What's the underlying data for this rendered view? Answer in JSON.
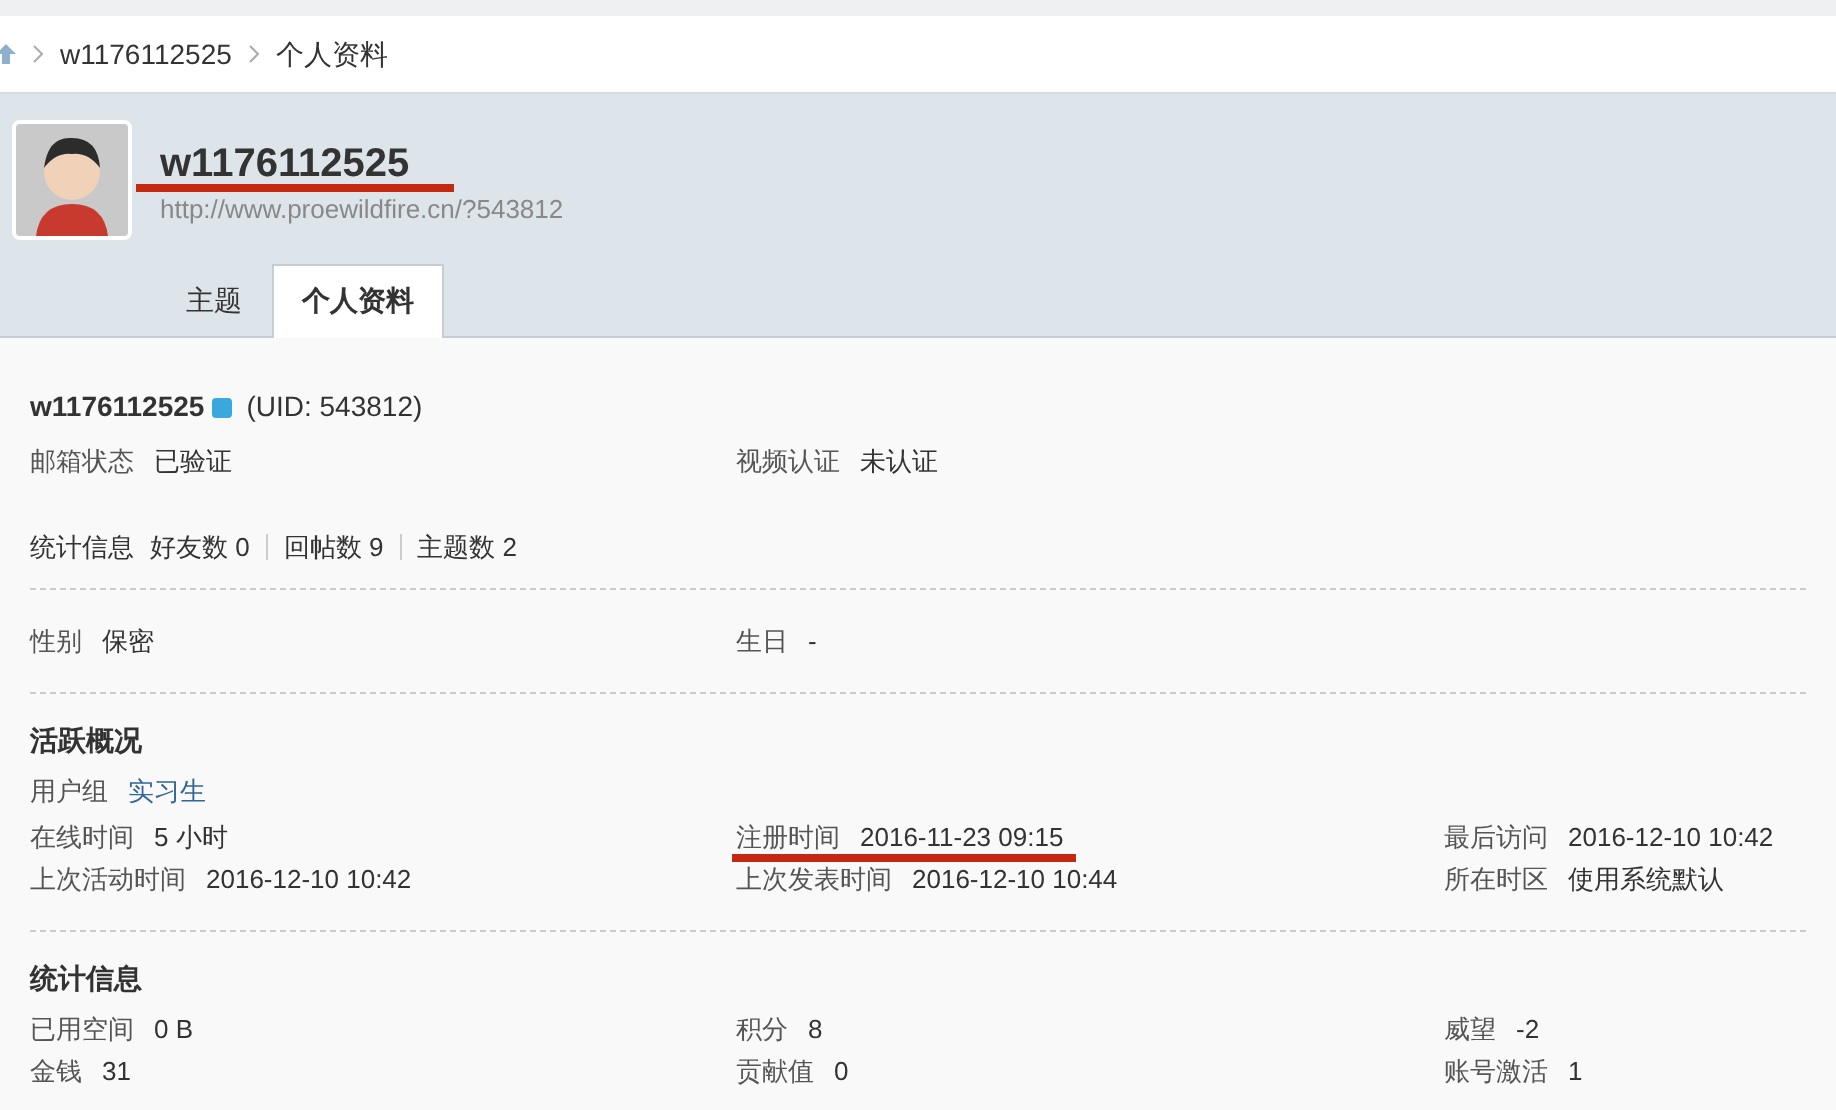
{
  "breadcrumb": [
    "w1176112525",
    "个人资料"
  ],
  "profile": {
    "username": "w1176112525",
    "marked": true,
    "url": "http://www.proewildfire.cn/?543812"
  },
  "tabs": [
    {
      "label": "主题",
      "selected": false
    },
    {
      "label": "个人资料",
      "selected": true
    }
  ],
  "identity": {
    "username": "w1176112525",
    "uid": "(UID: 543812)",
    "fields": [
      {
        "label": "邮箱状态",
        "value": "已验证",
        "marked": false
      },
      {
        "label": "视频认证",
        "value": "未认证",
        "marked": false
      }
    ]
  },
  "counts": {
    "label": "统计信息",
    "items": [
      "好友数 0",
      "回帖数 9",
      "主题数 2"
    ]
  },
  "personal": {
    "fields": [
      {
        "label": "性别",
        "value": "保密",
        "marked": false
      },
      {
        "label": "生日",
        "value": "-",
        "marked": false
      }
    ]
  },
  "activity": {
    "title": "活跃概况",
    "user_group": {
      "label": "用户组",
      "value": "实习生"
    },
    "fields": [
      {
        "label": "在线时间",
        "value": "5 小时",
        "marked": false
      },
      {
        "label": "注册时间",
        "value": "2016-11-23 09:15",
        "marked": true
      },
      {
        "label": "最后访问",
        "value": "2016-12-10 10:42",
        "marked": false
      },
      {
        "label": "上次活动时间",
        "value": "2016-12-10 10:42",
        "marked": false
      },
      {
        "label": "上次发表时间",
        "value": "2016-12-10 10:44",
        "marked": false
      },
      {
        "label": "所在时区",
        "value": "使用系统默认",
        "marked": false
      }
    ]
  },
  "statistics": {
    "title": "统计信息",
    "fields": [
      {
        "label": "已用空间",
        "value": "0 B",
        "marked": false
      },
      {
        "label": "积分",
        "value": "8",
        "marked": false
      },
      {
        "label": "威望",
        "value": "-2",
        "marked": false
      },
      {
        "label": "金钱",
        "value": "31",
        "marked": false
      },
      {
        "label": "贡献值",
        "value": "0",
        "marked": false
      },
      {
        "label": "账号激活",
        "value": "1",
        "marked": false
      }
    ]
  }
}
